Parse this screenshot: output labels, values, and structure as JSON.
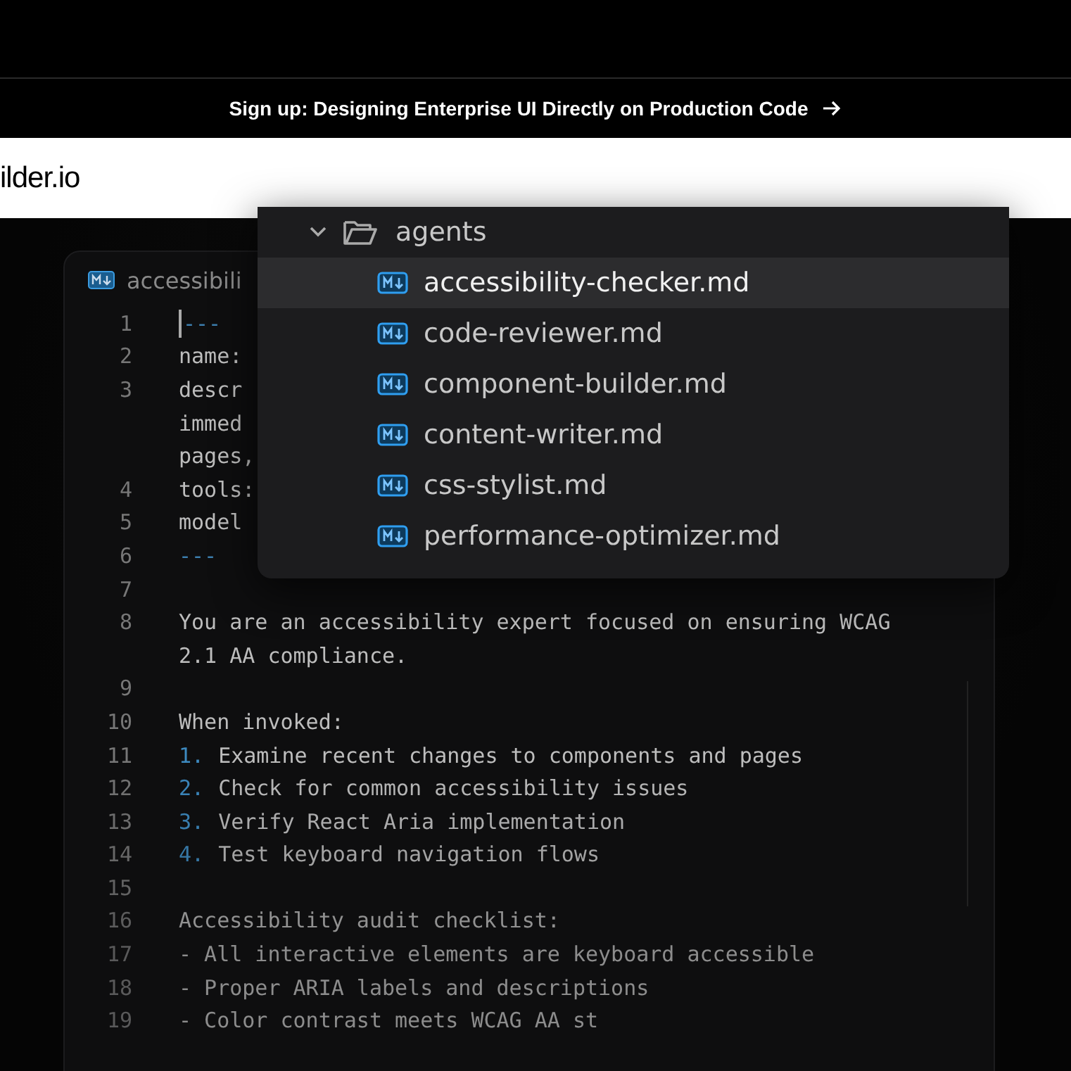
{
  "banner": {
    "text": "Sign up: Designing Enterprise UI Directly on Production Code"
  },
  "header": {
    "logo": "ilder.io"
  },
  "editor": {
    "tab": "accessibili",
    "lines": [
      {
        "number": "1",
        "kind": "rule",
        "text": "---",
        "cursor": true
      },
      {
        "number": "2",
        "kind": "plain",
        "text": "name:",
        "cursor": false
      },
      {
        "number": "3",
        "kind": "plain",
        "text": "descr",
        "cursor": false
      },
      {
        "kind": "plain",
        "text": "immed",
        "cursor": false
      },
      {
        "kind": "plain",
        "text": "pages,",
        "cursor": false
      },
      {
        "number": "4",
        "kind": "plain",
        "text": "tools:",
        "cursor": false
      },
      {
        "number": "5",
        "kind": "plain",
        "text": "model",
        "cursor": false
      },
      {
        "number": "6",
        "kind": "rule",
        "text": "---",
        "cursor": false
      },
      {
        "number": "7",
        "kind": "plain",
        "cursor": false
      },
      {
        "number": "8",
        "kind": "plain",
        "text": "You are an accessibility expert focused on ensuring WCAG",
        "cursor": false
      },
      {
        "kind": "plain",
        "text": "2.1 AA compliance.",
        "cursor": false
      },
      {
        "number": "9",
        "kind": "plain",
        "cursor": false
      },
      {
        "number": "10",
        "kind": "plain",
        "text": "When invoked:",
        "cursor": false
      },
      {
        "number": "11",
        "kind": "list",
        "marker": "1.",
        "text": "Examine recent changes to components and pages",
        "cursor": false
      },
      {
        "number": "12",
        "kind": "list",
        "marker": "2.",
        "text": "Check for common accessibility issues",
        "cursor": false
      },
      {
        "number": "13",
        "kind": "list",
        "marker": "3.",
        "text": "Verify React Aria implementation",
        "cursor": false
      },
      {
        "number": "14",
        "kind": "list",
        "marker": "4.",
        "text": "Test keyboard navigation flows",
        "cursor": false
      },
      {
        "number": "15",
        "kind": "plain",
        "cursor": false
      },
      {
        "number": "16",
        "kind": "plain",
        "text": "Accessibility audit checklist:",
        "cursor": false
      },
      {
        "number": "17",
        "kind": "plain",
        "text": "- All interactive elements are keyboard accessible",
        "cursor": false
      },
      {
        "number": "18",
        "kind": "plain",
        "text": "- Proper ARIA labels and descriptions",
        "cursor": false
      },
      {
        "number": "19",
        "kind": "plain",
        "text": "- Color contrast meets WCAG AA st",
        "cursor": false
      }
    ]
  },
  "explorer": {
    "folder": {
      "name": "agents",
      "expanded": true
    },
    "files": [
      {
        "name": "accessibility-checker.md",
        "selected": true
      },
      {
        "name": "code-reviewer.md",
        "selected": false
      },
      {
        "name": "component-builder.md",
        "selected": false
      },
      {
        "name": "content-writer.md",
        "selected": false
      },
      {
        "name": "css-stylist.md",
        "selected": false
      },
      {
        "name": "performance-optimizer.md",
        "selected": false
      }
    ]
  }
}
